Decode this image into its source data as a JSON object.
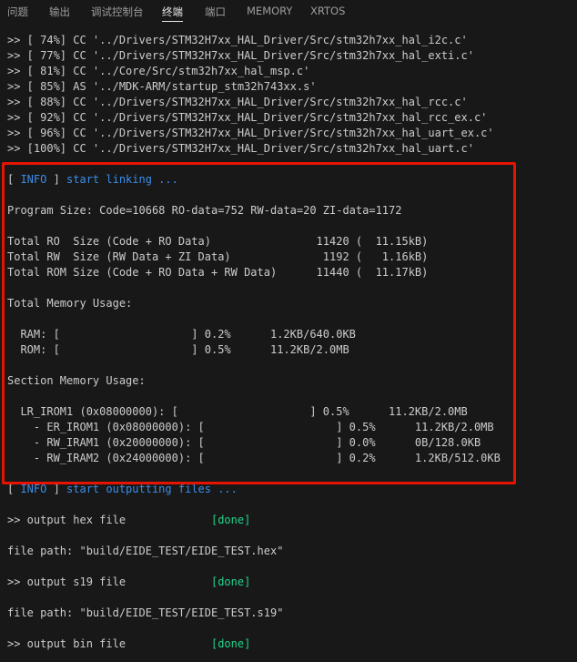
{
  "tabs": [
    {
      "label": "问题"
    },
    {
      "label": "输出"
    },
    {
      "label": "调试控制台"
    },
    {
      "label": "终端"
    },
    {
      "label": "端口"
    },
    {
      "label": "MEMORY"
    },
    {
      "label": "XRTOS"
    }
  ],
  "active_tab": "终端",
  "colors": {
    "background": "#181818",
    "text": "#cccccc",
    "info_blue": "#3b8eea",
    "done_green": "#23d18b",
    "highlight_red": "#e51400"
  },
  "terminal": {
    "compile_lines": [
      ">> [ 74%] CC '../Drivers/STM32H7xx_HAL_Driver/Src/stm32h7xx_hal_i2c.c'",
      ">> [ 77%] CC '../Drivers/STM32H7xx_HAL_Driver/Src/stm32h7xx_hal_exti.c'",
      ">> [ 81%] CC '../Core/Src/stm32h7xx_hal_msp.c'",
      ">> [ 85%] AS '../MDK-ARM/startup_stm32h743xx.s'",
      ">> [ 88%] CC '../Drivers/STM32H7xx_HAL_Driver/Src/stm32h7xx_hal_rcc.c'",
      ">> [ 92%] CC '../Drivers/STM32H7xx_HAL_Driver/Src/stm32h7xx_hal_rcc_ex.c'",
      ">> [ 96%] CC '../Drivers/STM32H7xx_HAL_Driver/Src/stm32h7xx_hal_uart_ex.c'",
      ">> [100%] CC '../Drivers/STM32H7xx_HAL_Driver/Src/stm32h7xx_hal_uart.c'"
    ],
    "linking": {
      "bracket_open": "[ ",
      "tag": "INFO",
      "bracket_close": " ]",
      "msg": " start linking ..."
    },
    "program_size": "Program Size: Code=10668 RO-data=752 RW-data=20 ZI-data=1172",
    "totals": [
      "Total RO  Size (Code + RO Data)                11420 (  11.15kB)",
      "Total RW  Size (RW Data + ZI Data)              1192 (   1.16kB)",
      "Total ROM Size (Code + RO Data + RW Data)      11440 (  11.17kB)"
    ],
    "memory_usage_title": "Total Memory Usage:",
    "memory_usage": [
      "  RAM: [                    ] 0.2%      1.2KB/640.0KB",
      "  ROM: [                    ] 0.5%      11.2KB/2.0MB"
    ],
    "section_usage_title": "Section Memory Usage:",
    "section_usage": [
      "  LR_IROM1 (0x08000000): [                    ] 0.5%      11.2KB/2.0MB",
      "    - ER_IROM1 (0x08000000): [                    ] 0.5%      11.2KB/2.0MB",
      "    - RW_IRAM1 (0x20000000): [                    ] 0.0%      0B/128.0KB",
      "    - RW_IRAM2 (0x24000000): [                    ] 0.2%      1.2KB/512.0KB"
    ],
    "outputting": {
      "bracket_open": "[ ",
      "tag": "INFO",
      "bracket_close": " ]",
      "msg": " start outputting files ..."
    },
    "outputs": [
      {
        "label": ">> output hex file             ",
        "status": "[done]",
        "path": "file path: \"build/EIDE_TEST/EIDE_TEST.hex\""
      },
      {
        "label": ">> output s19 file             ",
        "status": "[done]",
        "path": "file path: \"build/EIDE_TEST/EIDE_TEST.s19\""
      },
      {
        "label": ">> output bin file             ",
        "status": "[done]"
      }
    ]
  }
}
